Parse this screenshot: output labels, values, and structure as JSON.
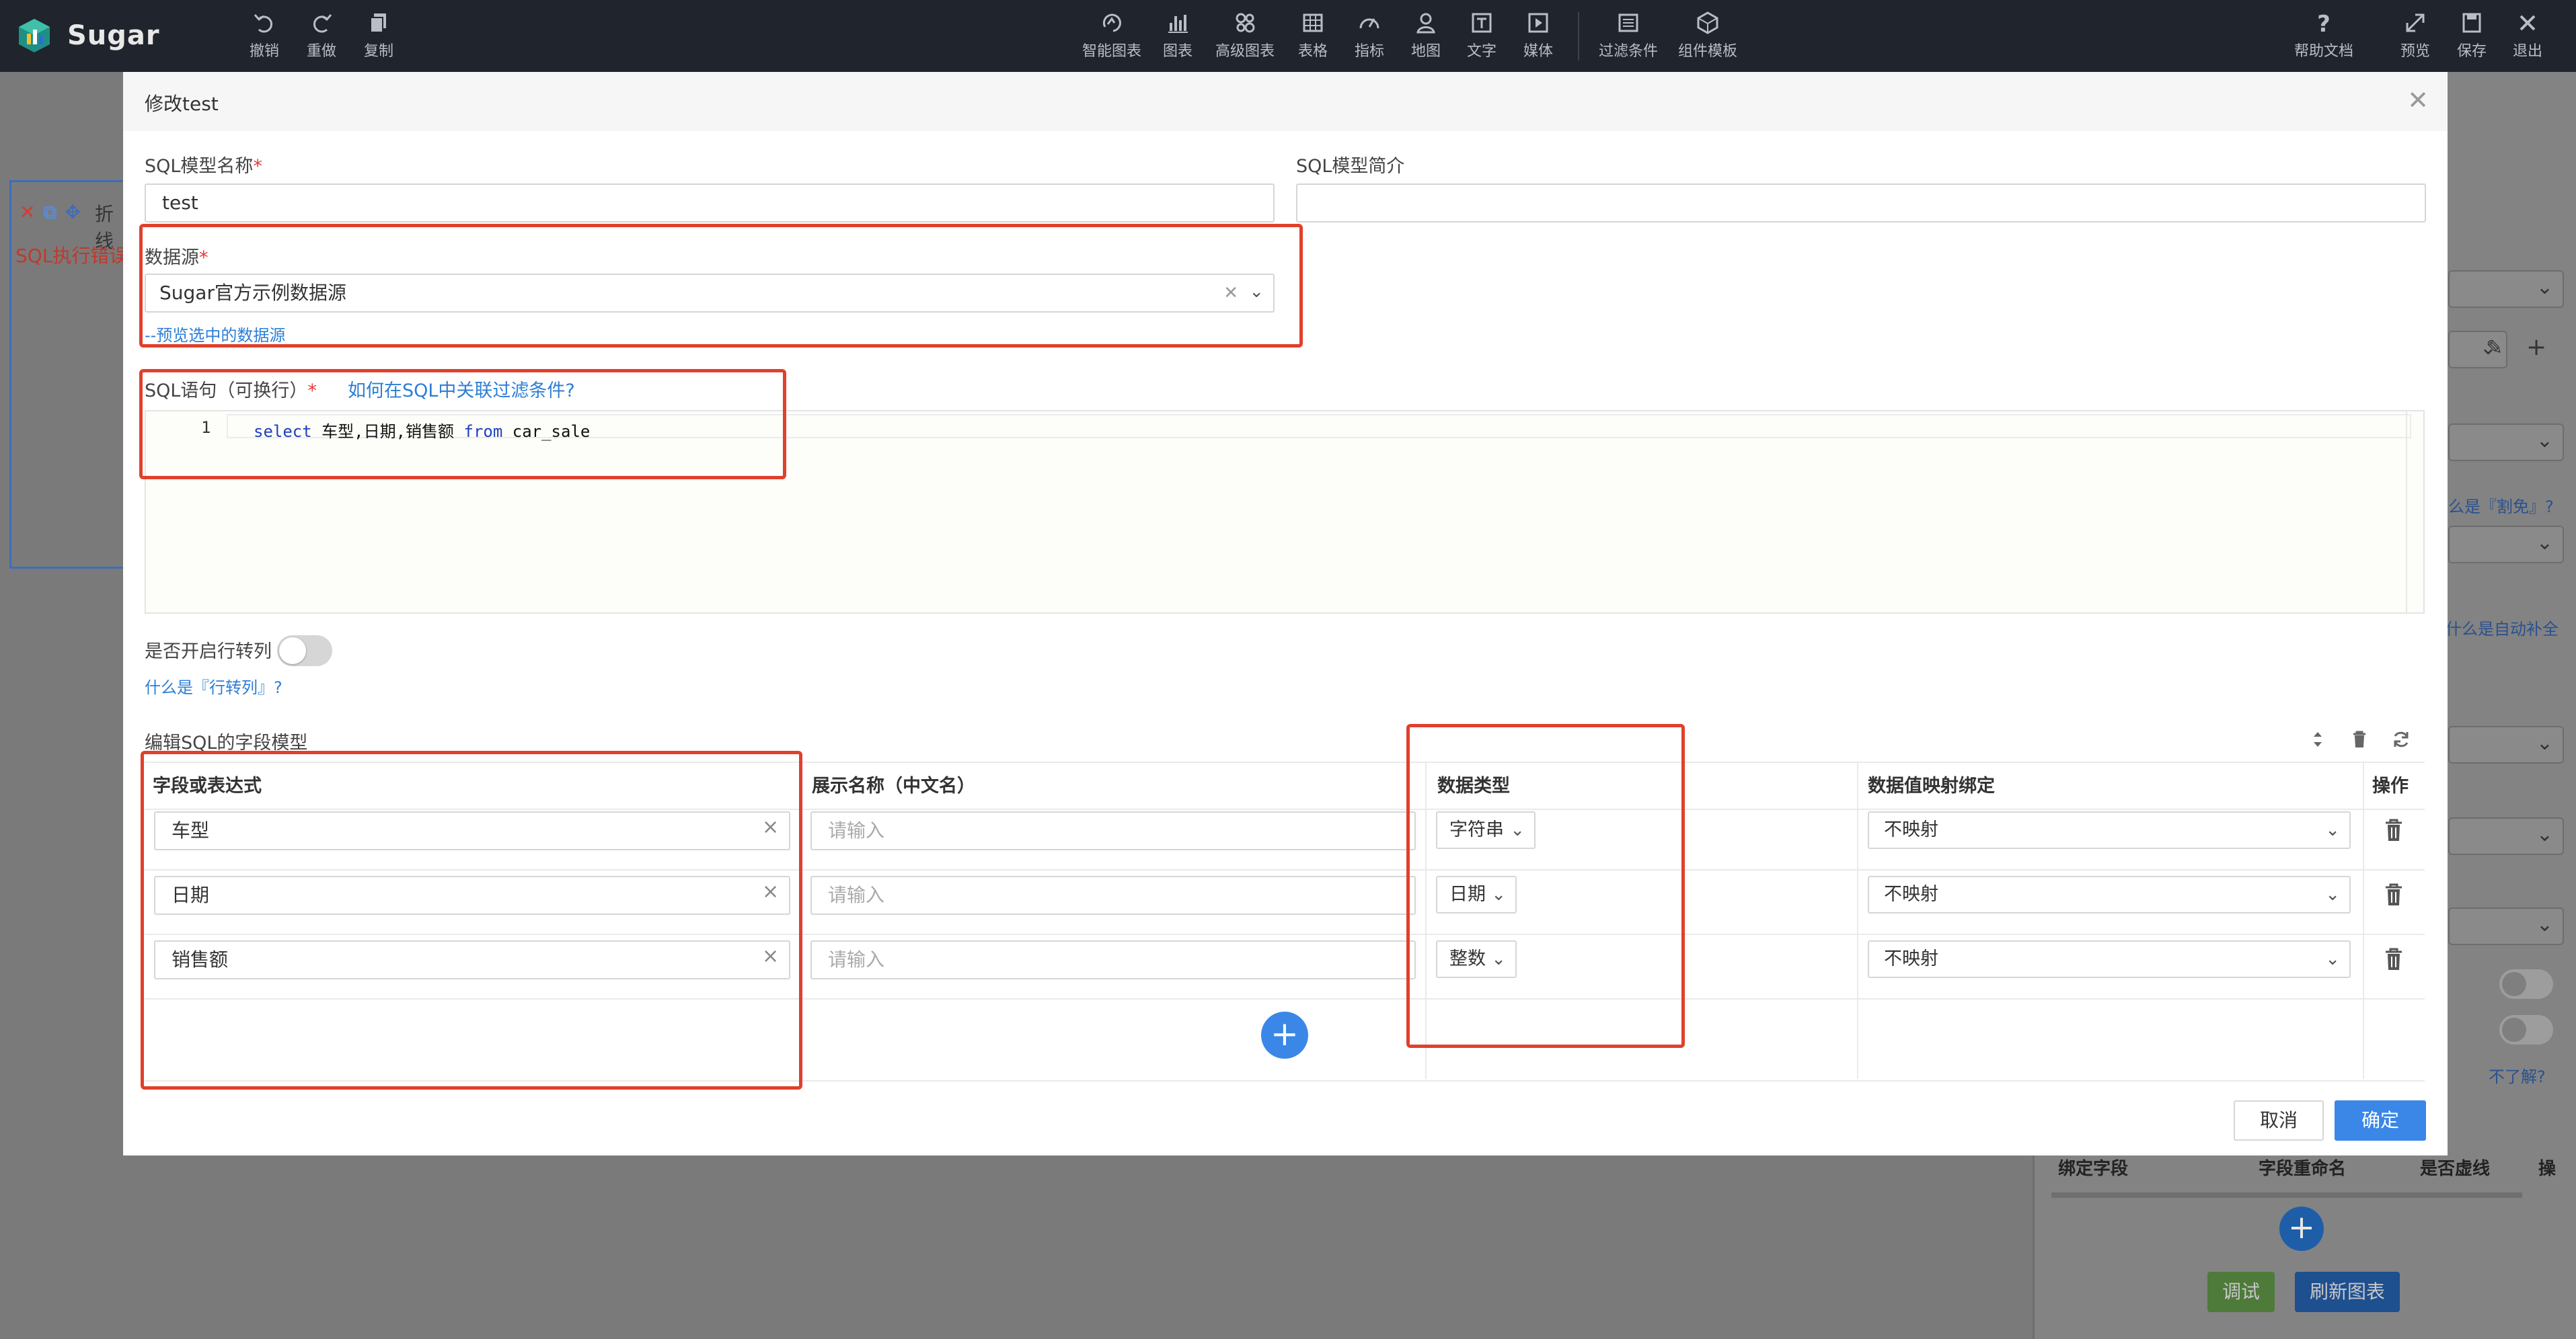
{
  "app": {
    "name": "Sugar"
  },
  "toolbar": {
    "left": [
      {
        "label": "撤销",
        "icon": "undo-icon"
      },
      {
        "label": "重做",
        "icon": "redo-icon"
      },
      {
        "label": "复制",
        "icon": "copy-icon"
      }
    ],
    "center": [
      {
        "label": "智能图表",
        "icon": "smart-chart-icon"
      },
      {
        "label": "图表",
        "icon": "bar-chart-icon"
      },
      {
        "label": "高级图表",
        "icon": "advanced-chart-icon"
      },
      {
        "label": "表格",
        "icon": "table-icon"
      },
      {
        "label": "指标",
        "icon": "gauge-icon"
      },
      {
        "label": "地图",
        "icon": "map-pin-icon"
      },
      {
        "label": "文字",
        "icon": "text-icon"
      },
      {
        "label": "媒体",
        "icon": "media-icon"
      },
      {
        "label": "过滤条件",
        "icon": "filter-icon"
      },
      {
        "label": "组件模板",
        "icon": "template-icon"
      }
    ],
    "right": [
      {
        "label": "帮助文档",
        "icon": "help-icon"
      },
      {
        "label": "预览",
        "icon": "expand-icon"
      },
      {
        "label": "保存",
        "icon": "save-icon"
      },
      {
        "label": "退出",
        "icon": "close-icon"
      }
    ]
  },
  "background": {
    "left_widget": {
      "fold_label": "折线",
      "error_text": "SQL执行错误"
    },
    "right_panel": {
      "link_1": "么是『割免』?",
      "link_2": "什么是自动补全",
      "link_3": "不了解?",
      "table_headers": [
        "绑定字段",
        "字段重命名",
        "是否虚线",
        "操"
      ],
      "buttons": {
        "debug": "调试",
        "refresh": "刷新图表"
      }
    }
  },
  "modal": {
    "title": "修改test",
    "sql_model_name": {
      "label": "SQL模型名称",
      "value": "test"
    },
    "sql_model_intro": {
      "label": "SQL模型简介",
      "value": ""
    },
    "datasource": {
      "label": "数据源",
      "value": "Sugar官方示例数据源",
      "preview_link": "--预览选中的数据源"
    },
    "sql": {
      "label": "SQL语句（可换行）",
      "help_link": "如何在SQL中关联过滤条件?",
      "line_number": "1",
      "keyword_select": "select",
      "fields": " 车型,日期,销售额 ",
      "keyword_from": "from",
      "table": " car_sale"
    },
    "row_to_column": {
      "label": "是否开启行转列",
      "enabled": false,
      "help_link": "什么是『行转列』?"
    },
    "field_model": {
      "title": "编辑SQL的字段模型",
      "columns": [
        "字段或表达式",
        "展示名称（中文名）",
        "数据类型",
        "数据值映射绑定",
        "操作"
      ],
      "placeholder": "请输入",
      "rows": [
        {
          "field": "车型",
          "display_name": "",
          "type": "字符串",
          "mapping": "不映射"
        },
        {
          "field": "日期",
          "display_name": "",
          "type": "日期",
          "mapping": "不映射"
        },
        {
          "field": "销售额",
          "display_name": "",
          "type": "整数",
          "mapping": "不映射"
        }
      ]
    },
    "buttons": {
      "cancel": "取消",
      "confirm": "确定"
    }
  },
  "colors": {
    "accent": "#3a87e8",
    "annotation": "#e0402c",
    "toolbar_bg": "#20242c",
    "link": "#2d7ed7"
  }
}
